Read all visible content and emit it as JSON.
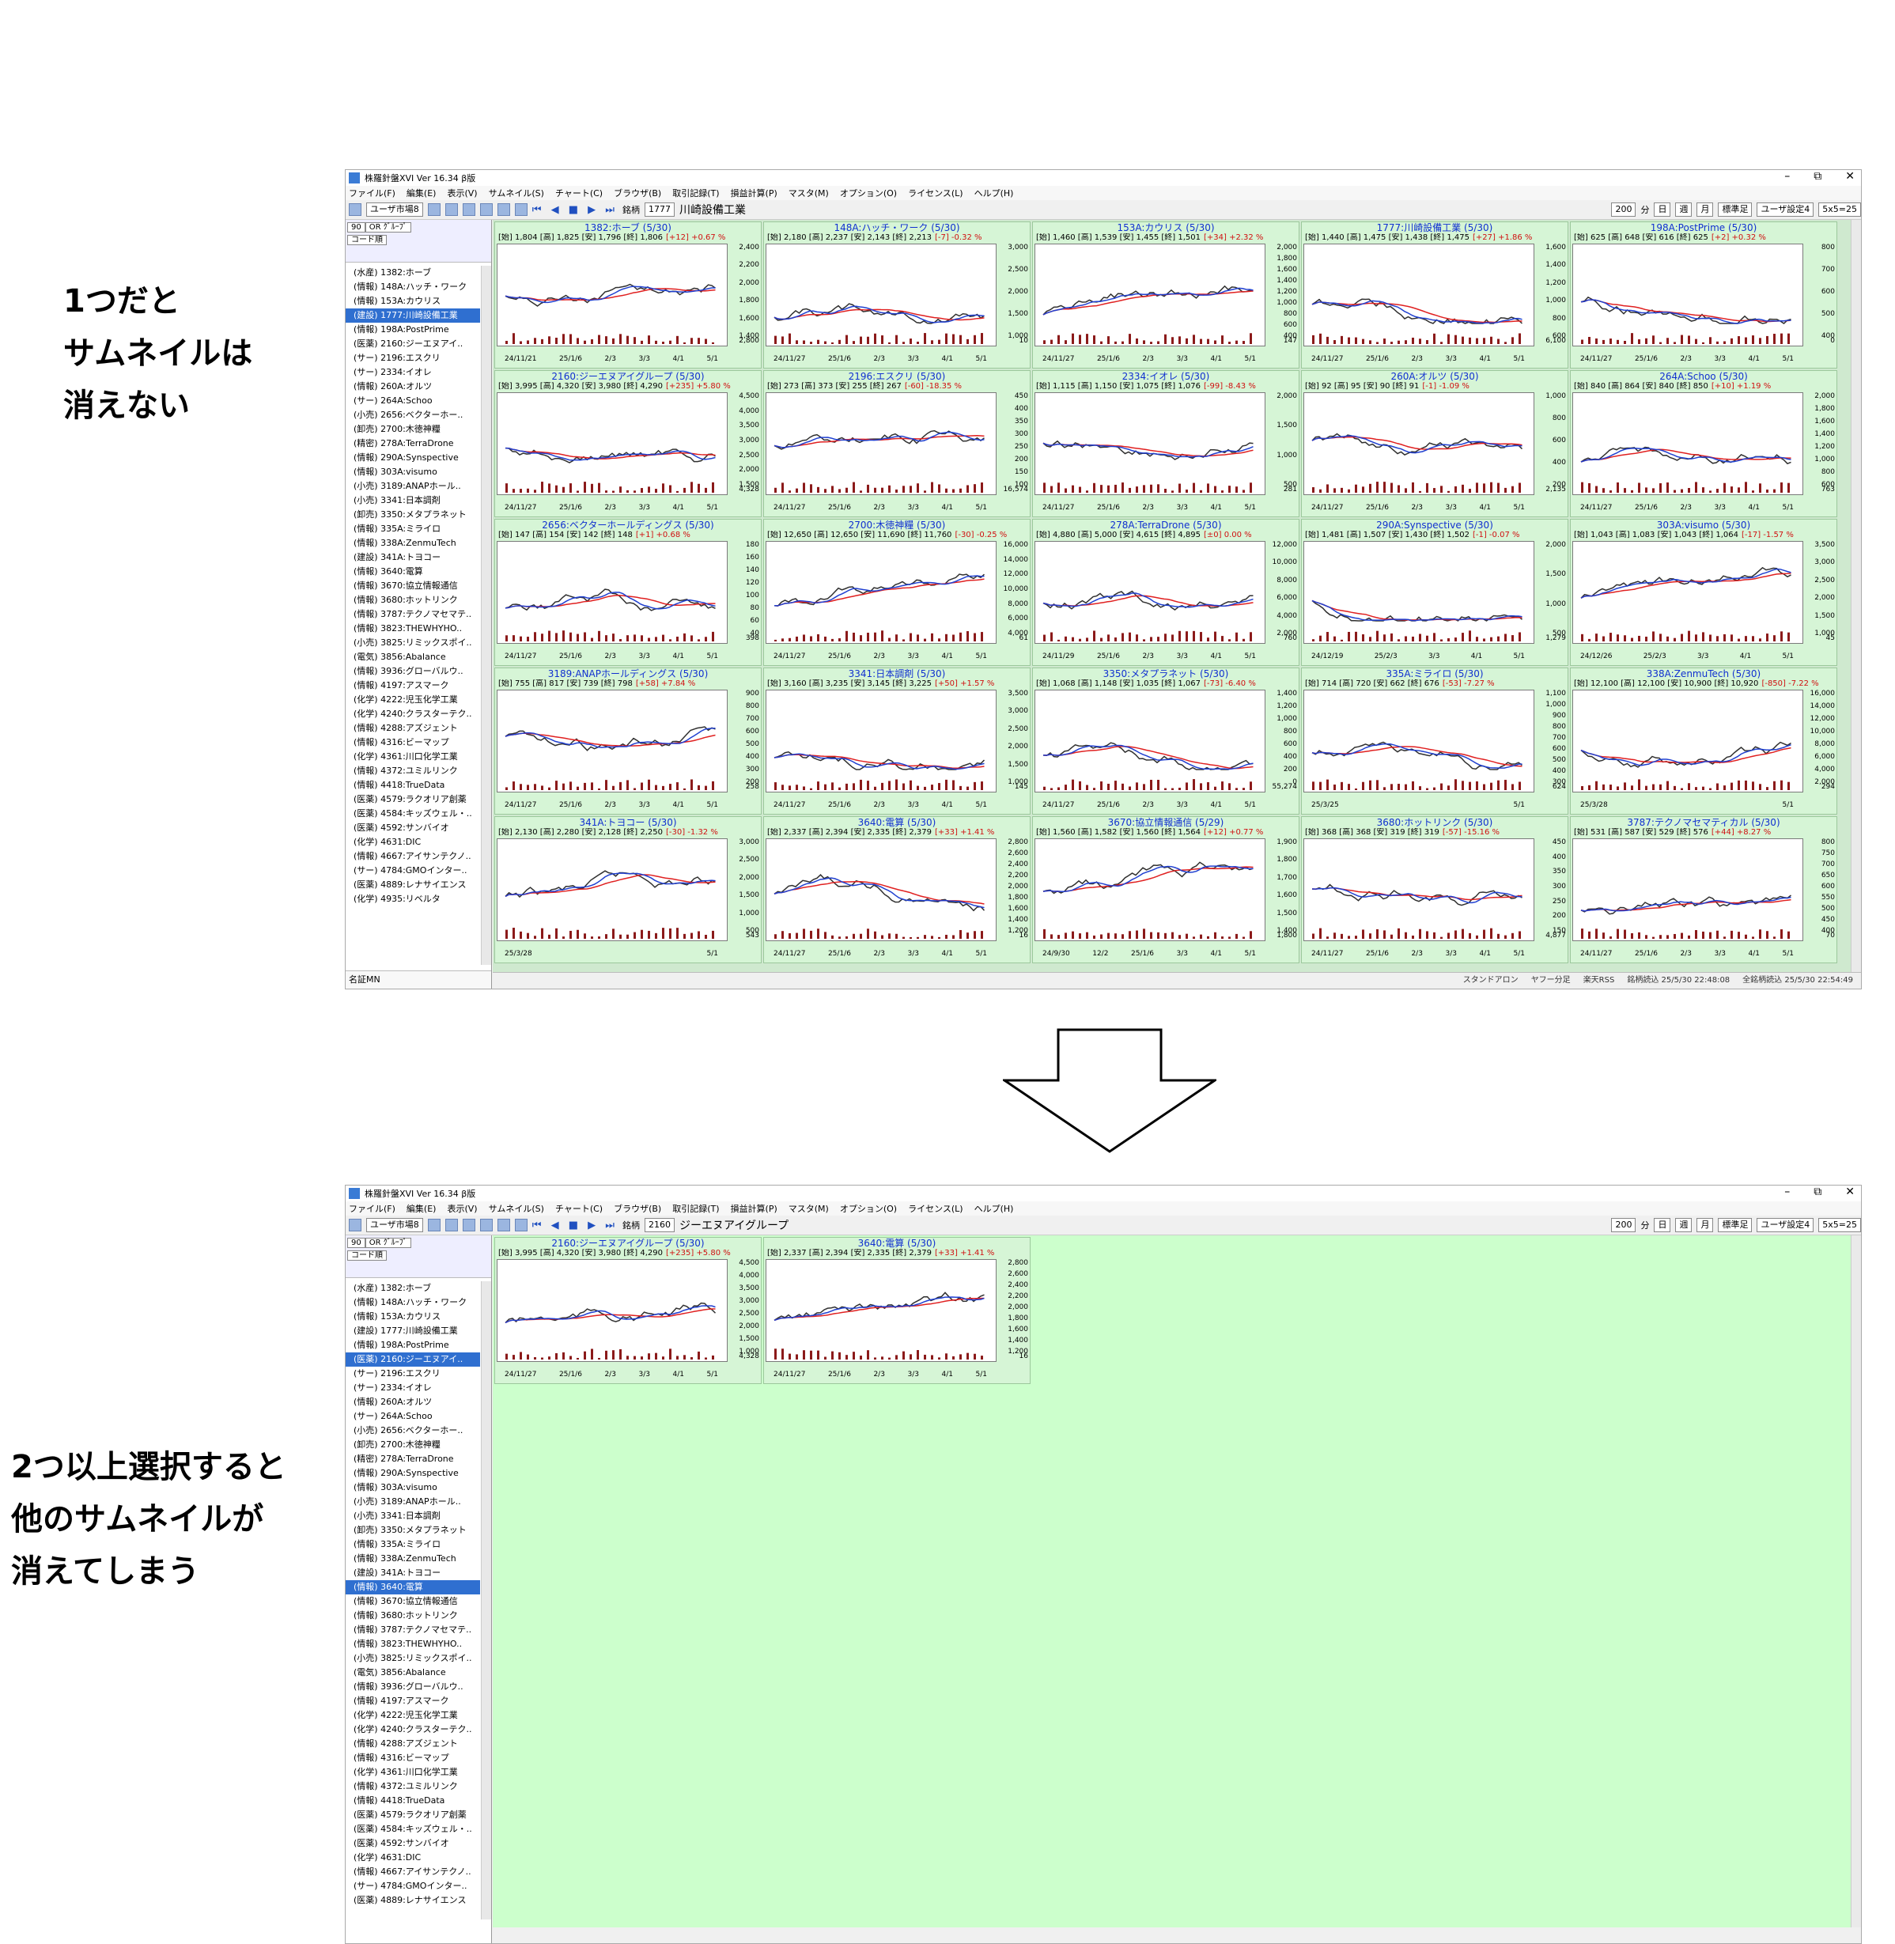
{
  "captions": {
    "top": [
      "1つだと",
      "サムネイルは",
      "消えない"
    ],
    "bottom": [
      "2つ以上選択すると",
      "他のサムネイルが",
      "消えてしまう"
    ]
  },
  "app": {
    "title": "株羅針盤XVI Ver 16.34 β版",
    "menu": [
      "ファイル(F)",
      "編集(E)",
      "表示(V)",
      "サムネイル(S)",
      "チャート(C)",
      "ブラウザ(B)",
      "取引記録(T)",
      "損益計算(P)",
      "マスタ(M)",
      "オプション(O)",
      "ライセンス(L)",
      "ヘルプ(H)"
    ],
    "toolbar": {
      "market_select": "ユーザ市場8",
      "meigara_label": "銘柄",
      "period": "200",
      "unit": "分",
      "day": "日",
      "week": "週",
      "month": "月",
      "std": "標準足",
      "user_setting": "ユーザ設定4",
      "grid_size": "5x5=25"
    },
    "left": {
      "count": "90",
      "group": "OR ｸﾞﾙｰﾌﾟ",
      "sort": "コード順",
      "footer": "名証MN"
    }
  },
  "window1": {
    "code": "1777",
    "name": "川崎設備工業",
    "status": [
      "スタンドアロン",
      "ヤフー分足",
      "楽天RSS",
      "銘柄読込 25/5/30 22:48:08",
      "全銘柄読込 25/5/30 22:54:49"
    ],
    "list": [
      "(水産) 1382:ホーブ",
      "(情報) 148A:ハッチ・ワーク",
      "(情報) 153A:カウリス",
      "(建設) 1777:川崎設備工業",
      "(情報) 198A:PostPrime",
      "(医薬) 2160:ジーエヌアイ..",
      "(サー) 2196:エスクリ",
      "(サー) 2334:イオレ",
      "(情報) 260A:オルツ",
      "(サー) 264A:Schoo",
      "(小売) 2656:ベクターホー..",
      "(卸売) 2700:木徳神糧",
      "(精密) 278A:TerraDrone",
      "(情報) 290A:Synspective",
      "(情報) 303A:visumo",
      "(小売) 3189:ANAPホール..",
      "(小売) 3341:日本調剤",
      "(卸売) 3350:メタプラネット",
      "(情報) 335A:ミライロ",
      "(情報) 338A:ZenmuTech",
      "(建設) 341A:トヨコー",
      "(情報) 3640:電算",
      "(情報) 3670:協立情報通信",
      "(情報) 3680:ホットリンク",
      "(情報) 3787:テクノマセマテ..",
      "(情報) 3823:THEWHYHO..",
      "(小売) 3825:リミックスポイ..",
      "(電気) 3856:Abalance",
      "(情報) 3936:グローバルウ..",
      "(情報) 4197:アスマーク",
      "(化学) 4222:児玉化学工業",
      "(化学) 4240:クラスターテク..",
      "(情報) 4288:アズジェント",
      "(情報) 4316:ビーマップ",
      "(化学) 4361:川口化学工業",
      "(情報) 4372:ユミルリンク",
      "(情報) 4418:TrueData",
      "(医薬) 4579:ラクオリア創薬",
      "(医薬) 4584:キッズウェル・..",
      "(医薬) 4592:サンバイオ",
      "(化学) 4631:DIC",
      "(情報) 4667:アイサンテクノ..",
      "(サー) 4784:GMOインター..",
      "(医薬) 4889:レナサイエンス",
      "(化学) 4935:リベルタ"
    ],
    "selected_index": 3,
    "tiles": [
      {
        "title": "1382:ホーブ (5/30)",
        "ohlc": "[始] 1,804 [高] 1,825 [安] 1,796 [終] 1,806",
        "chg": "[+12] +0.67 %",
        "y": [
          "2,400",
          "2,200",
          "2,000",
          "1,800",
          "1,600",
          "1,400"
        ],
        "x": [
          "24/11/21",
          "25/1/6",
          "2/3",
          "3/3",
          "4/1",
          "5/1"
        ],
        "vol": "2,800"
      },
      {
        "title": "148A:ハッチ・ワーク (5/30)",
        "ohlc": "[始] 2,180 [高] 2,237 [安] 2,143 [終] 2,213",
        "chg": "[-7] -0.32 %",
        "y": [
          "3,000",
          "2,500",
          "2,000",
          "1,500",
          "1,000"
        ],
        "x": [
          "24/11/27",
          "25/1/6",
          "2/3",
          "3/3",
          "4/1",
          "5/1"
        ],
        "vol": "10"
      },
      {
        "title": "153A:カウリス (5/30)",
        "ohlc": "[始] 1,460 [高] 1,539 [安] 1,455 [終] 1,501",
        "chg": "[+34] +2.32 %",
        "y": [
          "2,000",
          "1,800",
          "1,600",
          "1,400",
          "1,200",
          "1,000",
          "800",
          "600",
          "400"
        ],
        "x": [
          "24/11/27",
          "25/1/6",
          "2/3",
          "3/3",
          "4/1",
          "5/1"
        ],
        "vol": "147"
      },
      {
        "title": "1777:川崎設備工業 (5/30)",
        "ohlc": "[始] 1,440 [高] 1,475 [安] 1,438 [終] 1,475",
        "chg": "[+27] +1.86 %",
        "y": [
          "1,600",
          "1,400",
          "1,200",
          "1,000",
          "800",
          "600"
        ],
        "x": [
          "24/11/27",
          "25/1/6",
          "2/3",
          "3/3",
          "4/1",
          "5/1"
        ],
        "vol": "6,100"
      },
      {
        "title": "198A:PostPrime (5/30)",
        "ohlc": "[始] 625 [高] 648 [安] 616 [終] 625",
        "chg": "[+2] +0.32 %",
        "y": [
          "800",
          "700",
          "600",
          "500",
          "400"
        ],
        "x": [
          "24/11/27",
          "25/1/6",
          "2/3",
          "3/3",
          "4/1",
          "5/1"
        ],
        "vol": "0"
      },
      {
        "title": "2160:ジーエヌアイグループ (5/30)",
        "ohlc": "[始] 3,995 [高] 4,320 [安] 3,980 [終] 4,290",
        "chg": "[+235] +5.80 %",
        "y": [
          "4,500",
          "4,000",
          "3,500",
          "3,000",
          "2,500",
          "2,000",
          "1,500"
        ],
        "x": [
          "24/11/27",
          "25/1/6",
          "2/3",
          "3/3",
          "4/1",
          "5/1"
        ],
        "vol": "4,328"
      },
      {
        "title": "2196:エスクリ (5/30)",
        "ohlc": "[始] 273 [高] 373 [安] 255 [終] 267",
        "chg": "[-60] -18.35 %",
        "y": [
          "450",
          "400",
          "350",
          "300",
          "250",
          "200",
          "150",
          "100"
        ],
        "x": [
          "24/11/27",
          "25/1/6",
          "2/3",
          "3/3",
          "4/1",
          "5/1"
        ],
        "vol": "16,574"
      },
      {
        "title": "2334:イオレ (5/30)",
        "ohlc": "[始] 1,115 [高] 1,150 [安] 1,075 [終] 1,076",
        "chg": "[-99] -8.43 %",
        "y": [
          "2,000",
          "1,500",
          "1,000",
          "500"
        ],
        "x": [
          "24/11/27",
          "25/1/6",
          "2/3",
          "3/3",
          "4/1",
          "5/1"
        ],
        "vol": "281"
      },
      {
        "title": "260A:オルツ (5/30)",
        "ohlc": "[始] 92 [高] 95 [安] 90 [終] 91",
        "chg": "[-1] -1.09 %",
        "y": [
          "1,000",
          "800",
          "600",
          "400",
          "200"
        ],
        "x": [
          "24/11/27",
          "25/1/6",
          "2/3",
          "3/3",
          "4/1",
          "5/1"
        ],
        "vol": "2,135"
      },
      {
        "title": "264A:Schoo (5/30)",
        "ohlc": "[始] 840 [高] 864 [安] 840 [終] 850",
        "chg": "[+10] +1.19 %",
        "y": [
          "2,000",
          "1,800",
          "1,600",
          "1,400",
          "1,200",
          "1,000",
          "800",
          "600"
        ],
        "x": [
          "24/11/27",
          "25/1/6",
          "2/3",
          "3/3",
          "4/1",
          "5/1"
        ],
        "vol": "763"
      },
      {
        "title": "2656:ベクターホールディングス (5/30)",
        "ohlc": "[始] 147 [高] 154 [安] 142 [終] 148",
        "chg": "[+1] +0.68 %",
        "y": [
          "180",
          "160",
          "140",
          "120",
          "100",
          "80",
          "60",
          "40"
        ],
        "x": [
          "24/11/27",
          "25/1/6",
          "2/3",
          "3/3",
          "4/1",
          "5/1"
        ],
        "vol": "398"
      },
      {
        "title": "2700:木徳神糧 (5/30)",
        "ohlc": "[始] 12,650 [高] 12,650 [安] 11,690 [終] 11,760",
        "chg": "[-30] -0.25 %",
        "y": [
          "16,000",
          "14,000",
          "12,000",
          "10,000",
          "8,000",
          "6,000",
          "4,000"
        ],
        "x": [
          "24/11/27",
          "25/1/6",
          "2/3",
          "3/3",
          "4/1",
          "5/1"
        ],
        "vol": "61"
      },
      {
        "title": "278A:TerraDrone (5/30)",
        "ohlc": "[始] 4,880 [高] 5,000 [安] 4,615 [終] 4,895",
        "chg": "[±0] 0.00 %",
        "y": [
          "12,000",
          "10,000",
          "8,000",
          "6,000",
          "4,000",
          "2,000"
        ],
        "x": [
          "24/11/29",
          "25/1/6",
          "2/3",
          "3/3",
          "4/1",
          "5/1"
        ],
        "vol": "760"
      },
      {
        "title": "290A:Synspective (5/30)",
        "ohlc": "[始] 1,481 [高] 1,507 [安] 1,430 [終] 1,502",
        "chg": "[-1] -0.07 %",
        "y": [
          "2,000",
          "1,500",
          "1,000",
          "500"
        ],
        "x": [
          "24/12/19",
          "25/2/3",
          "3/3",
          "4/1",
          "5/1"
        ],
        "vol": "1,279"
      },
      {
        "title": "303A:visumo (5/30)",
        "ohlc": "[始] 1,043 [高] 1,083 [安] 1,043 [終] 1,064",
        "chg": "[-17] -1.57 %",
        "y": [
          "3,500",
          "3,000",
          "2,500",
          "2,000",
          "1,500",
          "1,000"
        ],
        "x": [
          "24/12/26",
          "25/2/3",
          "3/3",
          "4/1",
          "5/1"
        ],
        "vol": "45"
      },
      {
        "title": "3189:ANAPホールディングス (5/30)",
        "ohlc": "[始] 755 [高] 817 [安] 739 [終] 798",
        "chg": "[+58] +7.84 %",
        "y": [
          "900",
          "800",
          "700",
          "600",
          "500",
          "400",
          "300",
          "200"
        ],
        "x": [
          "24/11/27",
          "25/1/6",
          "2/3",
          "3/3",
          "4/1",
          "5/1"
        ],
        "vol": "258"
      },
      {
        "title": "3341:日本調剤 (5/30)",
        "ohlc": "[始] 3,160 [高] 3,235 [安] 3,145 [終] 3,225",
        "chg": "[+50] +1.57 %",
        "y": [
          "3,500",
          "3,000",
          "2,500",
          "2,000",
          "1,500",
          "1,000"
        ],
        "x": [
          "24/11/27",
          "25/1/6",
          "2/3",
          "3/3",
          "4/1",
          "5/1"
        ],
        "vol": "145"
      },
      {
        "title": "3350:メタプラネット (5/30)",
        "ohlc": "[始] 1,068 [高] 1,148 [安] 1,035 [終] 1,067",
        "chg": "[-73] -6.40 %",
        "y": [
          "1,400",
          "1,200",
          "1,000",
          "800",
          "600",
          "400",
          "200",
          "0"
        ],
        "x": [
          "24/11/27",
          "25/1/6",
          "2/3",
          "3/3",
          "4/1",
          "5/1"
        ],
        "vol": "55,274"
      },
      {
        "title": "335A:ミライロ (5/30)",
        "ohlc": "[始] 714 [高] 720 [安] 662 [終] 676",
        "chg": "[-53] -7.27 %",
        "y": [
          "1,100",
          "1,000",
          "900",
          "800",
          "700",
          "600",
          "500",
          "400",
          "300"
        ],
        "x": [
          "25/3/25",
          "5/1"
        ],
        "vol": "624"
      },
      {
        "title": "338A:ZenmuTech (5/30)",
        "ohlc": "[始] 12,100 [高] 12,100 [安] 10,900 [終] 10,920",
        "chg": "[-850] -7.22 %",
        "y": [
          "16,000",
          "14,000",
          "12,000",
          "10,000",
          "8,000",
          "6,000",
          "4,000",
          "2,000"
        ],
        "x": [
          "25/3/28",
          "5/1"
        ],
        "vol": "294"
      },
      {
        "title": "341A:トヨコー (5/30)",
        "ohlc": "[始] 2,130 [高] 2,280 [安] 2,128 [終] 2,250",
        "chg": "[-30] -1.32 %",
        "y": [
          "3,000",
          "2,500",
          "2,000",
          "1,500",
          "1,000",
          "500"
        ],
        "x": [
          "25/3/28",
          "5/1"
        ],
        "vol": "543"
      },
      {
        "title": "3640:電算 (5/30)",
        "ohlc": "[始] 2,337 [高] 2,394 [安] 2,335 [終] 2,379",
        "chg": "[+33] +1.41 %",
        "y": [
          "2,800",
          "2,600",
          "2,400",
          "2,200",
          "2,000",
          "1,800",
          "1,600",
          "1,400",
          "1,200"
        ],
        "x": [
          "24/11/27",
          "25/1/6",
          "2/3",
          "3/3",
          "4/1",
          "5/1"
        ],
        "vol": "16"
      },
      {
        "title": "3670:協立情報通信 (5/29)",
        "ohlc": "[始] 1,560 [高] 1,582 [安] 1,560 [終] 1,564",
        "chg": "[+12] +0.77 %",
        "y": [
          "1,900",
          "1,800",
          "1,700",
          "1,600",
          "1,500",
          "1,400"
        ],
        "x": [
          "24/9/30",
          "12/2",
          "25/1/6",
          "3/3",
          "4/1",
          "5/1"
        ],
        "vol": "1,800"
      },
      {
        "title": "3680:ホットリンク (5/30)",
        "ohlc": "[始] 368 [高] 368 [安] 319 [終] 319",
        "chg": "[-57] -15.16 %",
        "y": [
          "450",
          "400",
          "350",
          "300",
          "250",
          "200",
          "150"
        ],
        "x": [
          "24/11/27",
          "25/1/6",
          "2/3",
          "3/3",
          "4/1",
          "5/1"
        ],
        "vol": "4,877"
      },
      {
        "title": "3787:テクノマセマティカル (5/30)",
        "ohlc": "[始] 531 [高] 587 [安] 529 [終] 576",
        "chg": "[+44] +8.27 %",
        "y": [
          "800",
          "750",
          "700",
          "650",
          "600",
          "550",
          "500",
          "450",
          "400"
        ],
        "x": [
          "24/11/27",
          "25/1/6",
          "2/3",
          "3/3",
          "4/1",
          "5/1"
        ],
        "vol": "70"
      }
    ]
  },
  "window2": {
    "code": "2160",
    "name": "ジーエヌアイグループ",
    "list": [
      "(水産) 1382:ホーブ",
      "(情報) 148A:ハッチ・ワーク",
      "(情報) 153A:カウリス",
      "(建設) 1777:川崎設備工業",
      "(情報) 198A:PostPrime",
      "(医薬) 2160:ジーエヌアイ..",
      "(サー) 2196:エスクリ",
      "(サー) 2334:イオレ",
      "(情報) 260A:オルツ",
      "(サー) 264A:Schoo",
      "(小売) 2656:ベクターホー..",
      "(卸売) 2700:木徳神糧",
      "(精密) 278A:TerraDrone",
      "(情報) 290A:Synspective",
      "(情報) 303A:visumo",
      "(小売) 3189:ANAPホール..",
      "(小売) 3341:日本調剤",
      "(卸売) 3350:メタプラネット",
      "(情報) 335A:ミライロ",
      "(情報) 338A:ZenmuTech",
      "(建設) 341A:トヨコー",
      "(情報) 3640:電算",
      "(情報) 3670:協立情報通信",
      "(情報) 3680:ホットリンク",
      "(情報) 3787:テクノマセマテ..",
      "(情報) 3823:THEWHYHO..",
      "(小売) 3825:リミックスポイ..",
      "(電気) 3856:Abalance",
      "(情報) 3936:グローバルウ..",
      "(情報) 4197:アスマーク",
      "(化学) 4222:児玉化学工業",
      "(化学) 4240:クラスターテク..",
      "(情報) 4288:アズジェント",
      "(情報) 4316:ビーマップ",
      "(化学) 4361:川口化学工業",
      "(情報) 4372:ユミルリンク",
      "(情報) 4418:TrueData",
      "(医薬) 4579:ラクオリア創薬",
      "(医薬) 4584:キッズウェル・..",
      "(医薬) 4592:サンバイオ",
      "(化学) 4631:DIC",
      "(情報) 4667:アイサンテクノ..",
      "(サー) 4784:GMOインター..",
      "(医薬) 4889:レナサイエンス"
    ],
    "selected_indices": [
      5,
      21
    ],
    "tiles": [
      {
        "title": "2160:ジーエヌアイグループ (5/30)",
        "ohlc": "[始] 3,995 [高] 4,320 [安] 3,980 [終] 4,290",
        "chg": "[+235] +5.80 %",
        "y": [
          "4,500",
          "4,000",
          "3,500",
          "3,000",
          "2,500",
          "2,000",
          "1,500",
          "1,000"
        ],
        "x": [
          "24/11/27",
          "25/1/6",
          "2/3",
          "3/3",
          "4/1",
          "5/1"
        ],
        "vol": "4,328"
      },
      {
        "title": "3640:電算 (5/30)",
        "ohlc": "[始] 2,337 [高] 2,394 [安] 2,335 [終] 2,379",
        "chg": "[+33] +1.41 %",
        "y": [
          "2,800",
          "2,600",
          "2,400",
          "2,200",
          "2,000",
          "1,800",
          "1,600",
          "1,400",
          "1,200"
        ],
        "x": [
          "24/11/27",
          "25/1/6",
          "2/3",
          "3/3",
          "4/1",
          "5/1"
        ],
        "vol": "16"
      }
    ]
  },
  "colors": {
    "grid_bg": "#ccffcc",
    "tile_title": "#1030d0",
    "change_red": "#d01010",
    "selection": "#2f6fd0",
    "ma_red": "#e02020",
    "ma_blue": "#2040d0",
    "ma_cyan": "#20b0c0"
  }
}
